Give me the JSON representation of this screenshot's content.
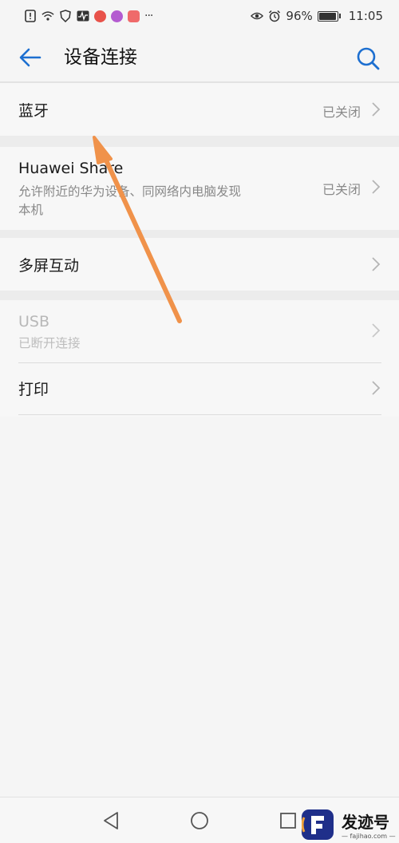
{
  "status_bar": {
    "battery": "96%",
    "time": "11:05",
    "more_label": "···"
  },
  "header": {
    "title": "设备连接"
  },
  "rows": {
    "bluetooth": {
      "title": "蓝牙",
      "status": "已关闭"
    },
    "huawei_share": {
      "title": "Huawei Share",
      "subtitle": "允许附近的华为设备、同网络内电脑发现本机",
      "status": "已关闭"
    },
    "multiscreen": {
      "title": "多屏互动"
    },
    "usb": {
      "title": "USB",
      "subtitle": "已断开连接"
    },
    "print": {
      "title": "打印"
    }
  },
  "watermark": {
    "text": "发迹号",
    "sub": "— fajihao.com —"
  },
  "colors": {
    "accent": "#1d6fd0",
    "annotation_arrow": "#f0924a"
  }
}
